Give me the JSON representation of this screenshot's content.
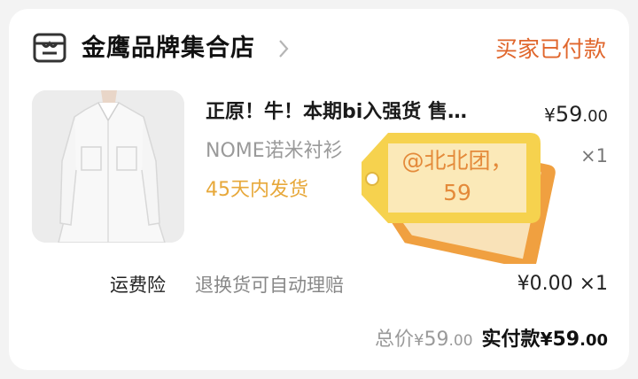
{
  "shop": {
    "name": "金鹰品牌集合店",
    "status": "买家已付款",
    "icon": "store-icon"
  },
  "item": {
    "title": "正原！牛！本期bi入强货 售…",
    "spec": "NOME诺米衬衫",
    "shipping": "45天内发货",
    "price_symbol": "¥",
    "price_int": "59",
    "price_dec": ".00",
    "quantity": "×1"
  },
  "tag": {
    "text": "@北北团，59"
  },
  "insurance": {
    "label": "运费险",
    "description": "退换货可自动理赔",
    "price": "¥0.00 ×1"
  },
  "totals": {
    "label": "总价",
    "symbol": "¥",
    "int": "59",
    "dec": ".00",
    "paid_label": "实付款",
    "paid_symbol": "¥",
    "paid_int": "59",
    "paid_dec": ".00"
  },
  "colors": {
    "status": "#e0662c",
    "shipping": "#e7a83a",
    "tag_front": "#f6d24e",
    "tag_back": "#f0a040"
  }
}
